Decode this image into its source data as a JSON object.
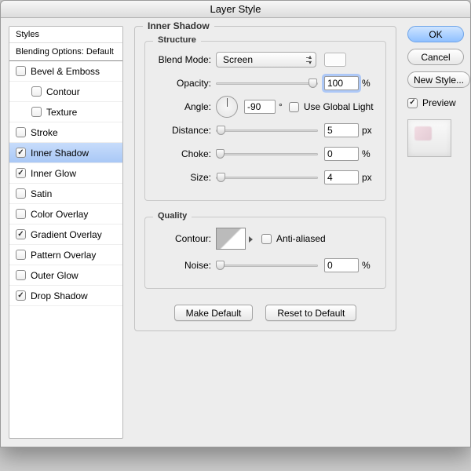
{
  "window": {
    "title": "Layer Style"
  },
  "sidebar": {
    "header": "Styles",
    "subheader": "Blending Options: Default",
    "items": [
      {
        "label": "Bevel & Emboss",
        "checked": false,
        "indent": false
      },
      {
        "label": "Contour",
        "checked": false,
        "indent": true
      },
      {
        "label": "Texture",
        "checked": false,
        "indent": true
      },
      {
        "label": "Stroke",
        "checked": false,
        "indent": false
      },
      {
        "label": "Inner Shadow",
        "checked": true,
        "indent": false,
        "selected": true
      },
      {
        "label": "Inner Glow",
        "checked": true,
        "indent": false
      },
      {
        "label": "Satin",
        "checked": false,
        "indent": false
      },
      {
        "label": "Color Overlay",
        "checked": false,
        "indent": false
      },
      {
        "label": "Gradient Overlay",
        "checked": true,
        "indent": false
      },
      {
        "label": "Pattern Overlay",
        "checked": false,
        "indent": false
      },
      {
        "label": "Outer Glow",
        "checked": false,
        "indent": false
      },
      {
        "label": "Drop Shadow",
        "checked": true,
        "indent": false
      }
    ]
  },
  "panel": {
    "title": "Inner Shadow",
    "structure": {
      "legend": "Structure",
      "blend_mode_label": "Blend Mode:",
      "blend_mode_value": "Screen",
      "opacity_label": "Opacity:",
      "opacity_value": "100",
      "opacity_unit": "%",
      "angle_label": "Angle:",
      "angle_value": "-90",
      "angle_unit": "°",
      "use_global_label": "Use Global Light",
      "use_global_checked": false,
      "distance_label": "Distance:",
      "distance_value": "5",
      "distance_unit": "px",
      "choke_label": "Choke:",
      "choke_value": "0",
      "choke_unit": "%",
      "size_label": "Size:",
      "size_value": "4",
      "size_unit": "px"
    },
    "quality": {
      "legend": "Quality",
      "contour_label": "Contour:",
      "antialiased_label": "Anti-aliased",
      "antialiased_checked": false,
      "noise_label": "Noise:",
      "noise_value": "0",
      "noise_unit": "%"
    },
    "buttons": {
      "make_default": "Make Default",
      "reset_default": "Reset to Default"
    }
  },
  "right": {
    "ok": "OK",
    "cancel": "Cancel",
    "new_style": "New Style...",
    "preview_label": "Preview",
    "preview_checked": true
  }
}
